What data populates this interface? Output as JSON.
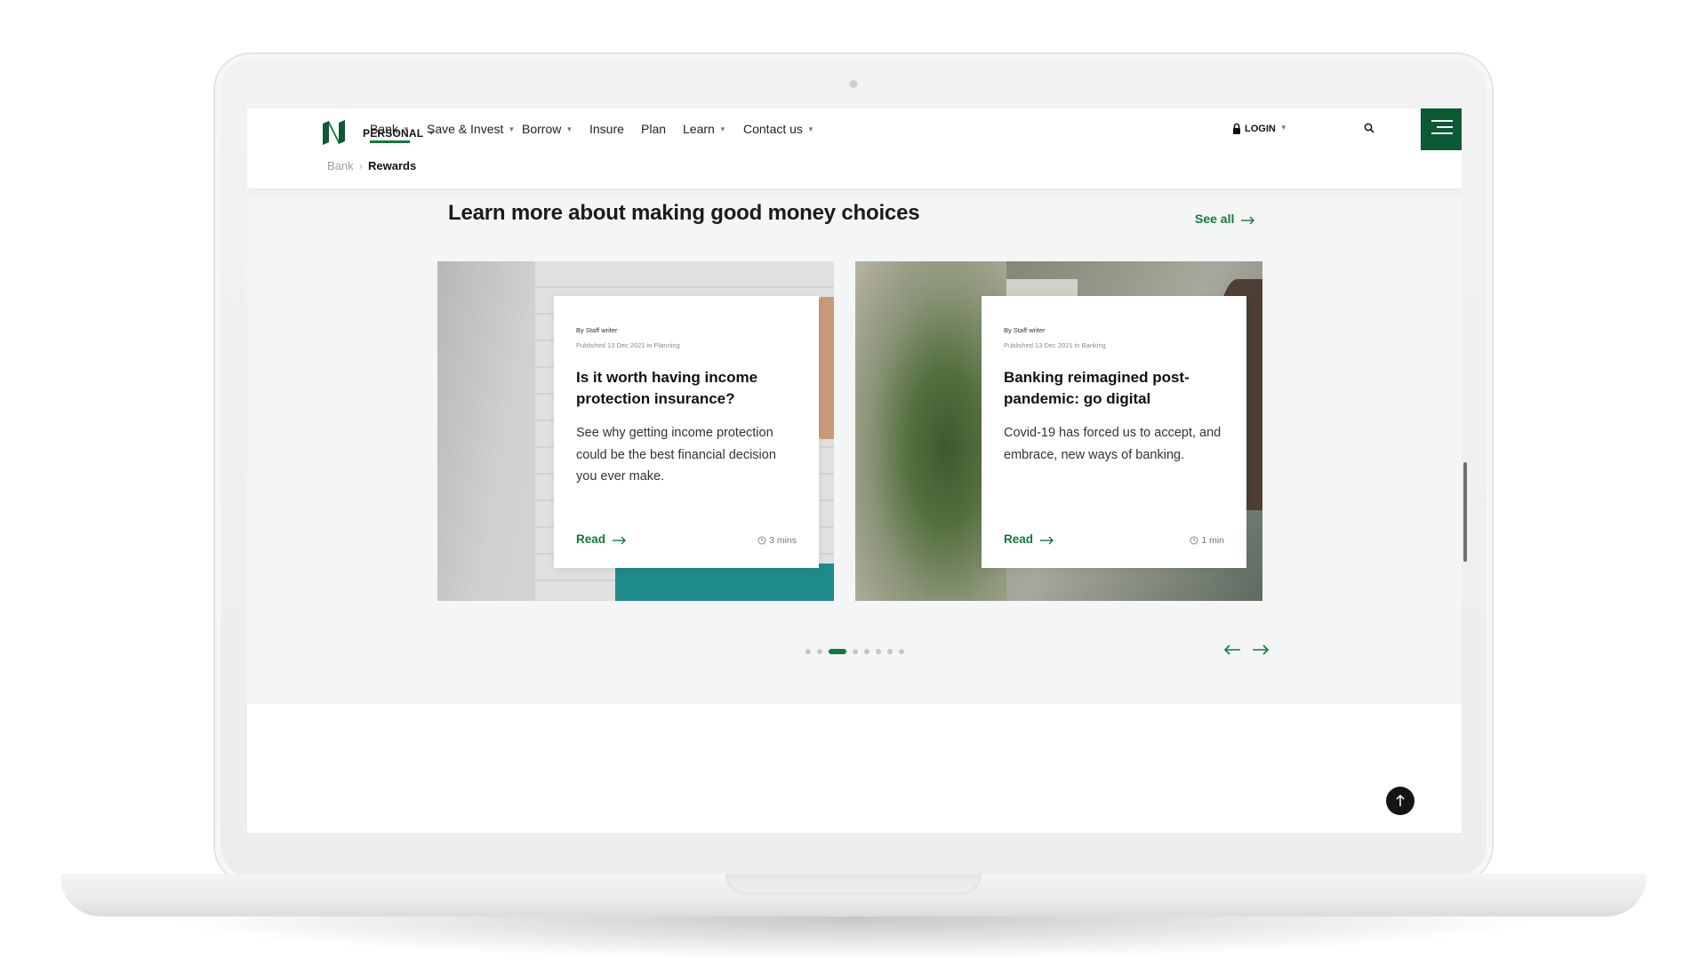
{
  "header": {
    "segment_label": "PERSONAL",
    "nav": [
      {
        "label": "Bank"
      },
      {
        "label": "Save & Invest"
      },
      {
        "label": "Borrow"
      },
      {
        "label": "Insure"
      },
      {
        "label": "Plan"
      },
      {
        "label": "Learn"
      },
      {
        "label": "Contact us"
      }
    ],
    "active_nav": "Bank",
    "login_label": "LOGIN"
  },
  "breadcrumb": {
    "parent": "Bank",
    "current": "Rewards"
  },
  "section": {
    "title": "Learn more about making good money choices",
    "see_all_label": "See all"
  },
  "articles": [
    {
      "byline": "By Staff writer",
      "published": "Published 13 Dec 2021 in Planning",
      "title": "Is it worth having income protection insurance?",
      "description": "See why getting income protection could be the best financial decision you ever make.",
      "cta": "Read",
      "read_time": "3 mins"
    },
    {
      "byline": "By Staff writer",
      "published": "Published 13 Dec 2021 in Banking",
      "title": "Banking reimagined post-pandemic: go digital",
      "description": "Covid-19 has forced us to accept, and embrace, new ways of banking.",
      "cta": "Read",
      "read_time": "1 min"
    }
  ],
  "carousel": {
    "total_slides": 8,
    "active_index": 2
  },
  "colors": {
    "brand_green": "#0f7a3c",
    "menu_green": "#0c5a35",
    "section_bg": "#f4f6f5"
  },
  "icons": [
    "logo-icon",
    "lock-icon",
    "search-icon",
    "menu-icon",
    "arrow-right-icon",
    "arrow-left-icon",
    "clock-icon",
    "arrow-up-icon"
  ]
}
